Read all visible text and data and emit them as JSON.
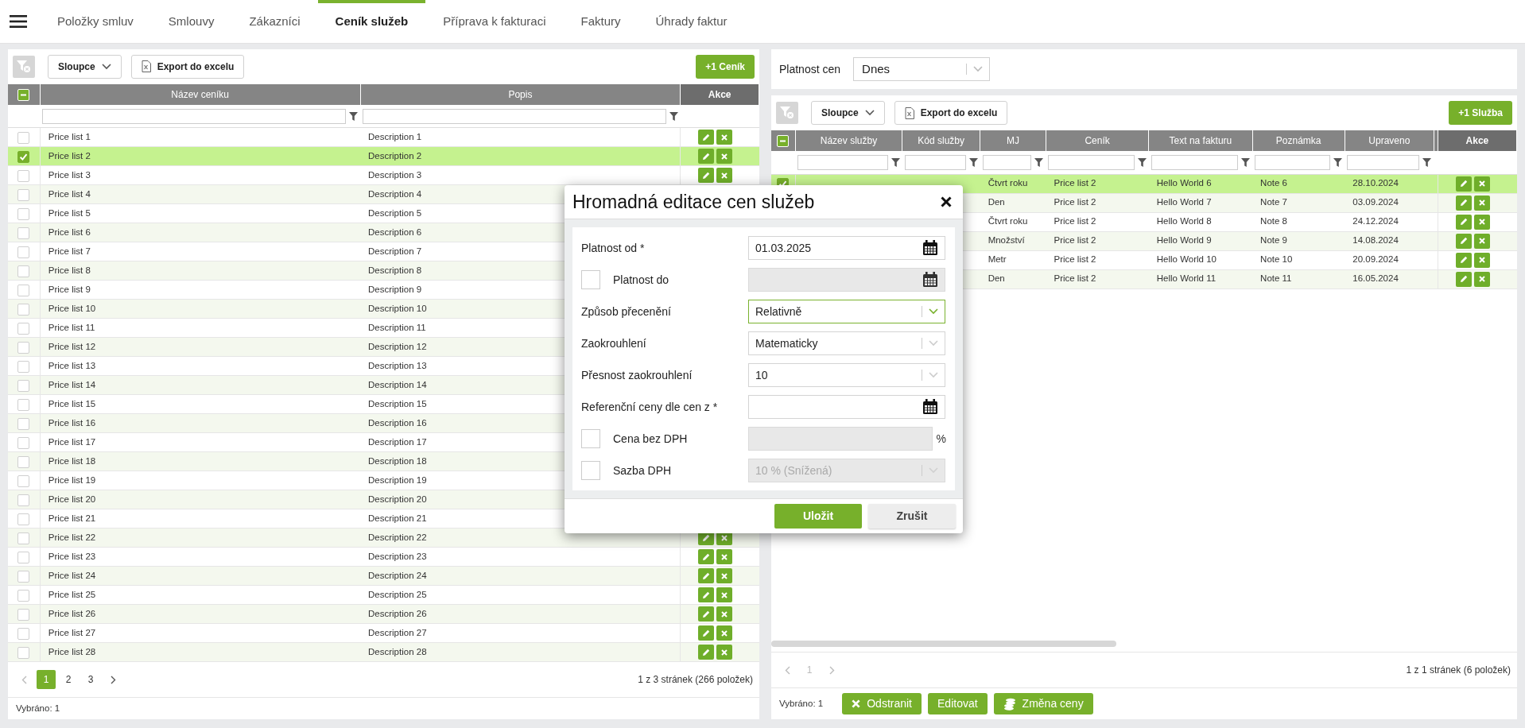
{
  "nav": {
    "tabs": [
      {
        "label": "Položky smluv",
        "selected": false
      },
      {
        "label": "Smlouvy",
        "selected": false
      },
      {
        "label": "Zákazníci",
        "selected": false
      },
      {
        "label": "Ceník služeb",
        "selected": true
      },
      {
        "label": "Příprava k fakturaci",
        "selected": false
      },
      {
        "label": "Faktury",
        "selected": false
      },
      {
        "label": "Úhrady faktur",
        "selected": false
      }
    ]
  },
  "price_lists": {
    "toolbar": {
      "columns_button": "Sloupce",
      "export_button": "Export do excelu",
      "add_button": "+1 Ceník"
    },
    "select_all_partial": true,
    "columns": [
      "Název ceníku",
      "Popis",
      "Akce"
    ],
    "rows": [
      {
        "name": "Price list 1",
        "description": "Description 1",
        "selected": false
      },
      {
        "name": "Price list 2",
        "description": "Description 2",
        "selected": true
      },
      {
        "name": "Price list 3",
        "description": "Description 3",
        "selected": false
      },
      {
        "name": "Price list 4",
        "description": "Description 4",
        "selected": false
      },
      {
        "name": "Price list 5",
        "description": "Description 5",
        "selected": false
      },
      {
        "name": "Price list 6",
        "description": "Description 6",
        "selected": false
      },
      {
        "name": "Price list 7",
        "description": "Description 7",
        "selected": false
      },
      {
        "name": "Price list 8",
        "description": "Description 8",
        "selected": false
      },
      {
        "name": "Price list 9",
        "description": "Description 9",
        "selected": false
      },
      {
        "name": "Price list 10",
        "description": "Description 10",
        "selected": false
      },
      {
        "name": "Price list 11",
        "description": "Description 11",
        "selected": false
      },
      {
        "name": "Price list 12",
        "description": "Description 12",
        "selected": false
      },
      {
        "name": "Price list 13",
        "description": "Description 13",
        "selected": false
      },
      {
        "name": "Price list 14",
        "description": "Description 14",
        "selected": false
      },
      {
        "name": "Price list 15",
        "description": "Description 15",
        "selected": false
      },
      {
        "name": "Price list 16",
        "description": "Description 16",
        "selected": false
      },
      {
        "name": "Price list 17",
        "description": "Description 17",
        "selected": false
      },
      {
        "name": "Price list 18",
        "description": "Description 18",
        "selected": false
      },
      {
        "name": "Price list 19",
        "description": "Description 19",
        "selected": false
      },
      {
        "name": "Price list 20",
        "description": "Description 20",
        "selected": false
      },
      {
        "name": "Price list 21",
        "description": "Description 21",
        "selected": false
      },
      {
        "name": "Price list 22",
        "description": "Description 22",
        "selected": false
      },
      {
        "name": "Price list 23",
        "description": "Description 23",
        "selected": false
      },
      {
        "name": "Price list 24",
        "description": "Description 24",
        "selected": false
      },
      {
        "name": "Price list 25",
        "description": "Description 25",
        "selected": false
      },
      {
        "name": "Price list 26",
        "description": "Description 26",
        "selected": false
      },
      {
        "name": "Price list 27",
        "description": "Description 27",
        "selected": false
      },
      {
        "name": "Price list 28",
        "description": "Description 28",
        "selected": false
      }
    ],
    "pagination": {
      "prev_disabled": true,
      "disabled": false,
      "pages": [
        {
          "label": "1",
          "selected": true
        },
        {
          "label": "2",
          "selected": false
        },
        {
          "label": "3",
          "selected": false
        }
      ],
      "summary": "1 z 3 stránek (266 položek)"
    },
    "selected_count": "Vybráno: 1"
  },
  "validity": {
    "label": "Platnost cen",
    "value": "Dnes"
  },
  "services": {
    "toolbar": {
      "columns_button": "Sloupce",
      "export_button": "Export do excelu",
      "add_button": "+1 Služba"
    },
    "select_all_partial": true,
    "columns": [
      "Název služby",
      "Kód služby",
      "MJ",
      "Ceník",
      "Text na fakturu",
      "Poznámka",
      "Upraveno",
      "Akce"
    ],
    "rows": [
      {
        "unit": "Čtvrt roku",
        "price_list": "Price list 2",
        "invoice_text": "Hello World 6",
        "note": "Note 6",
        "modified": "28.10.2024",
        "selected": true
      },
      {
        "unit": "Den",
        "price_list": "Price list 2",
        "invoice_text": "Hello World 7",
        "note": "Note 7",
        "modified": "03.09.2024",
        "selected": false
      },
      {
        "unit": "Čtvrt roku",
        "price_list": "Price list 2",
        "invoice_text": "Hello World 8",
        "note": "Note 8",
        "modified": "24.12.2024",
        "selected": false
      },
      {
        "unit": "Množství",
        "price_list": "Price list 2",
        "invoice_text": "Hello World 9",
        "note": "Note 9",
        "modified": "14.08.2024",
        "selected": false
      },
      {
        "unit": "Metr",
        "price_list": "Price list 2",
        "invoice_text": "Hello World 10",
        "note": "Note 10",
        "modified": "20.09.2024",
        "selected": false
      },
      {
        "unit": "Den",
        "price_list": "Price list 2",
        "invoice_text": "Hello World 11",
        "note": "Note 11",
        "modified": "16.05.2024",
        "selected": false
      }
    ],
    "pagination": {
      "disabled": true,
      "pages": [
        {
          "label": "1",
          "selected": true
        }
      ],
      "summary": "1 z 1 stránek (6 položek)"
    },
    "selected_count": "Vybráno: 1",
    "actions": [
      {
        "label": "Odstranit",
        "kind": "delete"
      },
      {
        "label": "Editovat",
        "kind": "edit"
      },
      {
        "label": "Změna ceny",
        "kind": "reprice"
      }
    ]
  },
  "dialog": {
    "title": "Hromadná editace cen služeb",
    "fields": [
      {
        "kind": "date",
        "label": "Platnost od *",
        "value": "01.03.2025",
        "disabled": false,
        "focused": false
      },
      {
        "kind": "date",
        "label": "Platnost do",
        "checked": false,
        "disabled": true,
        "focused": false
      },
      {
        "kind": "select",
        "label": "Způsob přecenění",
        "value": "Relativně",
        "disabled": false,
        "focused": true
      },
      {
        "kind": "select",
        "label": "Zaokrouhlení",
        "value": "Matematicky",
        "disabled": false,
        "focused": false
      },
      {
        "kind": "select",
        "label": "Přesnost zaokrouhlení",
        "value": "10",
        "disabled": false,
        "focused": false
      },
      {
        "kind": "date",
        "label": "Referenční ceny dle cen z *",
        "disabled": false,
        "focused": false
      },
      {
        "kind": "number",
        "label": "Cena bez DPH",
        "checked": false,
        "disabled": true,
        "focused": false,
        "suffix": "%"
      },
      {
        "kind": "select",
        "label": "Sazba DPH",
        "value": "10 % (Snížená)",
        "checked": false,
        "disabled": true,
        "focused": false
      }
    ],
    "buttons": [
      {
        "label": "Uložit",
        "kind": "primary"
      },
      {
        "label": "Zrušit",
        "kind": "secondary"
      }
    ]
  }
}
